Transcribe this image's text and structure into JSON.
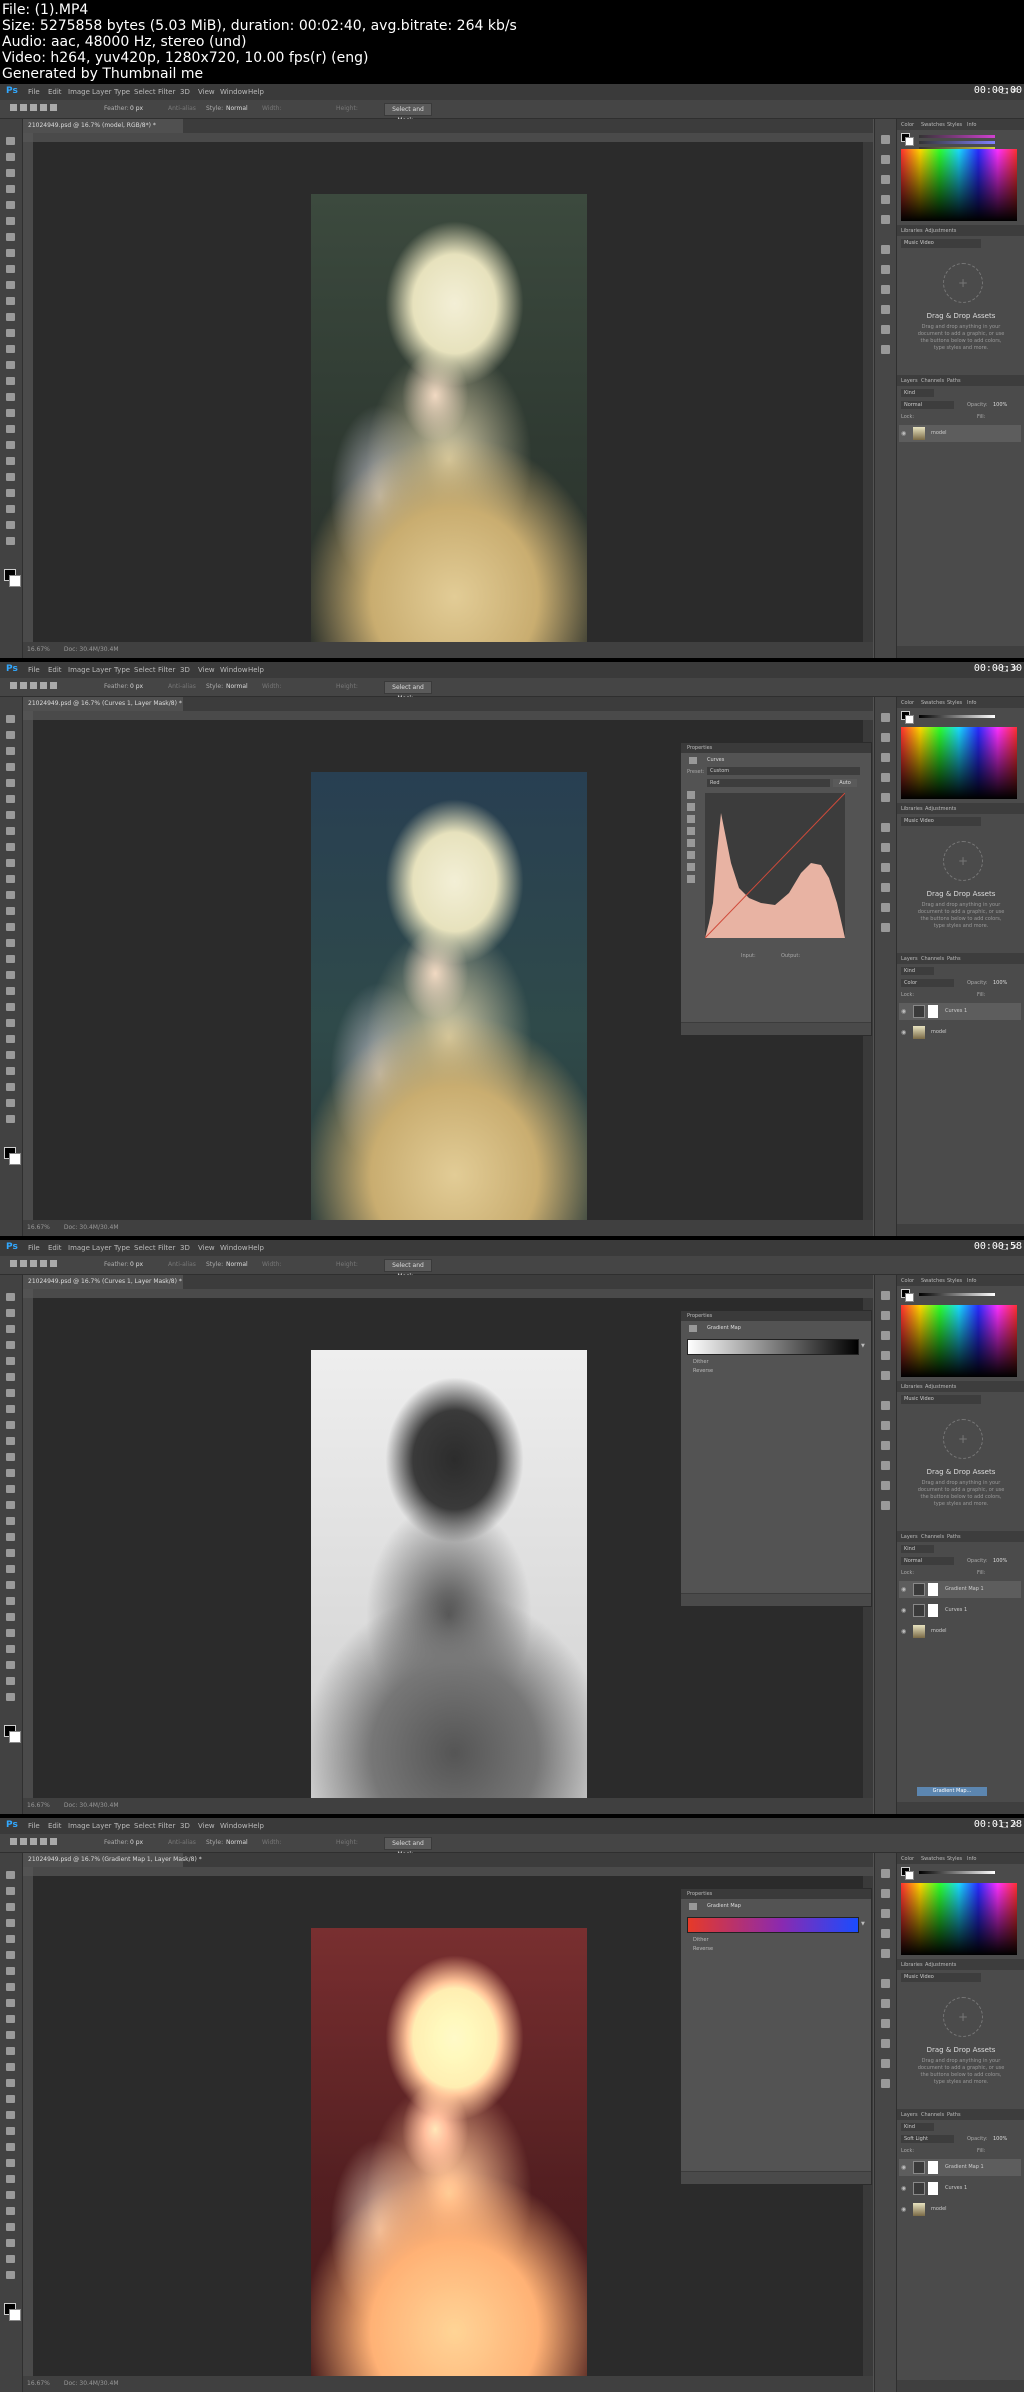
{
  "header": {
    "file": "File: (1).MP4",
    "size": "Size: 5275858 bytes (5.03 MiB), duration: 00:02:40, avg.bitrate: 264 kb/s",
    "audio": "Audio: aac, 48000 Hz, stereo (und)",
    "video": "Video: h264, yuv420p, 1280x720, 10.00 fps(r) (eng)",
    "generated": "Generated by Thumbnail me"
  },
  "app": {
    "logo": "Ps",
    "menu": [
      "File",
      "Edit",
      "Image",
      "Layer",
      "Type",
      "Select",
      "Filter",
      "3D",
      "View",
      "Window",
      "Help"
    ],
    "options": {
      "feather": "Feather:",
      "feather_value": "0 px",
      "anti_alias": "Anti-alias",
      "style": "Style:",
      "style_value": "Normal",
      "width": "Width:",
      "height": "Height:",
      "select_mask": "Select and Mask..."
    },
    "status": "16.67%",
    "doc_label": "Doc: 30.4M/30.4M",
    "color_tabs": [
      "Color",
      "Swatches",
      "Styles",
      "Info"
    ],
    "lib_tabs": [
      "Libraries",
      "Adjustments"
    ],
    "lib_select": "Music Video",
    "lib_title": "Drag & Drop Assets",
    "lib_text": "Drag and drop anything in your document to add a graphic, or use the buttons below to add colors, type styles and more.",
    "layer_tabs": [
      "Layers",
      "Channels",
      "Paths"
    ],
    "kind": "Kind",
    "opacity": "Opacity:",
    "opacity_value": "100%",
    "fill": "Fill:",
    "lock": "Lock:",
    "colors": {
      "ps_blue": "#31a8ff",
      "bg": "#535353",
      "canvas": "#2b2b2b"
    }
  },
  "frames": [
    {
      "tab": "21024949.psd @ 16.7% (model, RGB/8*) *",
      "timestamp": "00:00:00",
      "blend": "Normal",
      "layers": [
        {
          "name": "model",
          "thumb": "photo",
          "active": true
        }
      ]
    },
    {
      "tab": "21024949.psd @ 16.7% (Curves 1, Layer Mask/8) *",
      "timestamp": "00:00:30",
      "blend": "Color",
      "props": {
        "title": "Properties",
        "type": "Curves",
        "preset_label": "Preset:",
        "preset": "Custom",
        "channel": "Red",
        "auto": "Auto",
        "input": "Input:",
        "output": "Output:"
      },
      "layers": [
        {
          "name": "Curves 1",
          "thumb": "adjust",
          "active": true
        },
        {
          "name": "model",
          "thumb": "photo",
          "active": false
        }
      ]
    },
    {
      "tab": "21024949.psd @ 16.7% (Curves 1, Layer Mask/8) *",
      "timestamp": "00:00:58",
      "blend": "Normal",
      "props": {
        "title": "Properties",
        "type": "Gradient Map",
        "dither": "Dither",
        "reverse": "Reverse"
      },
      "drag_label": "Gradient Map...",
      "layers": [
        {
          "name": "Gradient Map 1",
          "thumb": "adjust",
          "active": true
        },
        {
          "name": "Curves 1",
          "thumb": "adjust",
          "active": false
        },
        {
          "name": "model",
          "thumb": "photo",
          "active": false
        }
      ]
    },
    {
      "tab": "21024949.psd @ 16.7% (Gradient Map 1, Layer Mask/8) *",
      "timestamp": "00:01:28",
      "blend": "Soft Light",
      "props": {
        "title": "Properties",
        "type": "Gradient Map",
        "dither": "Dither",
        "reverse": "Reverse"
      },
      "layers": [
        {
          "name": "Gradient Map 1",
          "thumb": "adjust",
          "active": true
        },
        {
          "name": "Curves 1",
          "thumb": "adjust",
          "active": false
        },
        {
          "name": "model",
          "thumb": "photo",
          "active": false
        }
      ]
    }
  ]
}
